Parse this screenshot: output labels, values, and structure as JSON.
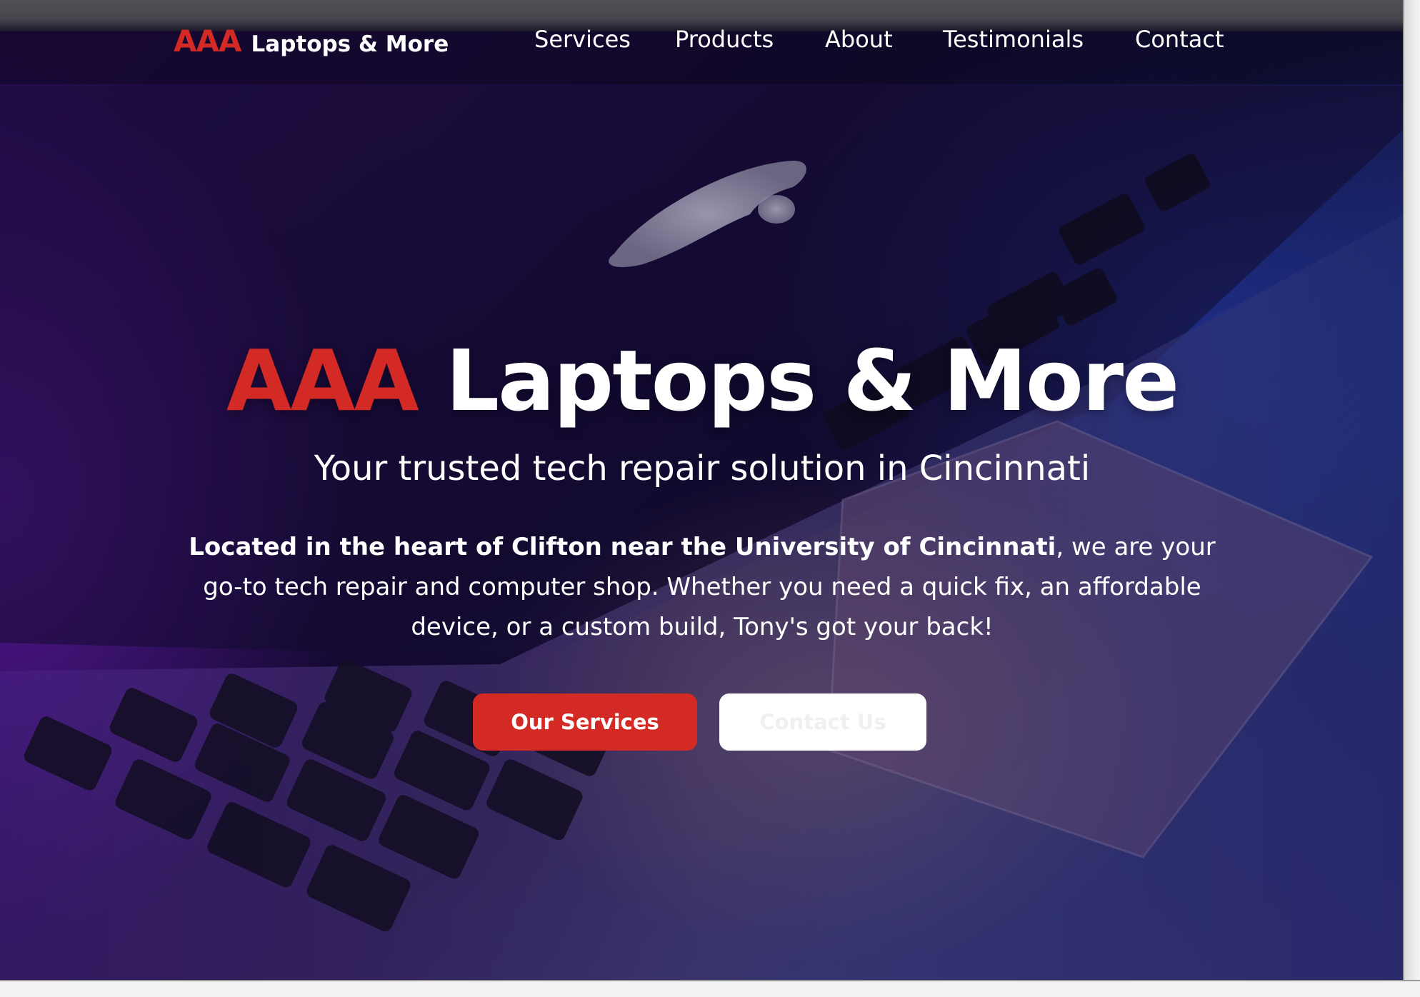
{
  "brand": {
    "highlight": "AAA",
    "name": "Laptops & More"
  },
  "nav": {
    "items": [
      "Services",
      "Products",
      "About",
      "Testimonials",
      "Contact"
    ]
  },
  "hero": {
    "title_highlight": "AAA",
    "title_rest": "Laptops & More",
    "subtitle": "Your trusted tech repair solution in Cincinnati",
    "description_bold": "Located in the heart of Clifton near the University of Cincinnati",
    "description_rest": ", we are your go-to tech repair and computer shop. Whether you need a quick fix, an affordable device, or a custom build, Tony's got your back!",
    "primary_button": "Our Services",
    "secondary_button": "Contact Us",
    "background_image": "laptop-keyboard-photo"
  },
  "colors": {
    "accent": "#d42a26",
    "text": "#ffffff",
    "secondary_button_bg": "#ffffff"
  }
}
